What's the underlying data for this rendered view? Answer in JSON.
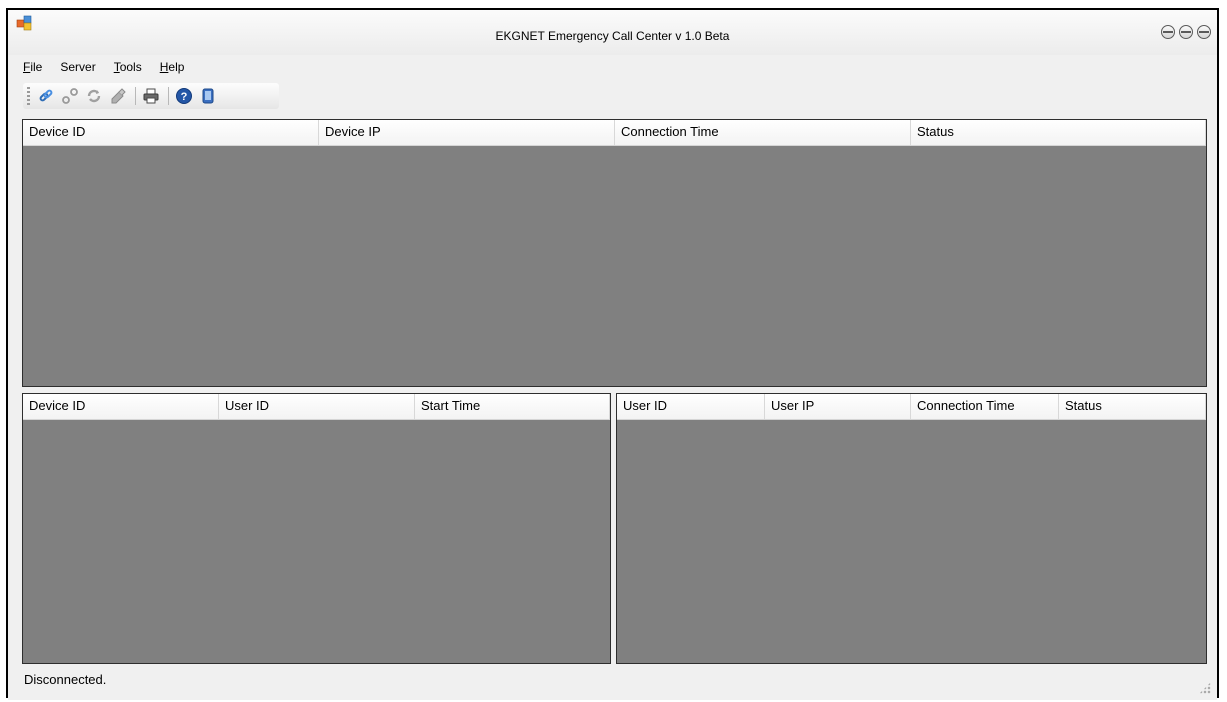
{
  "window": {
    "title": "EKGNET Emergency Call Center v 1.0 Beta"
  },
  "menu": [
    {
      "mnemonic": "F",
      "rest": "ile"
    },
    {
      "mnemonic": "",
      "rest": "Server"
    },
    {
      "mnemonic": "T",
      "rest": "ools"
    },
    {
      "mnemonic": "H",
      "rest": "elp"
    }
  ],
  "toolbar": {
    "icons": [
      "connect-icon",
      "disconnect-icon",
      "refresh-icon",
      "clear-icon",
      "print-icon",
      "help-icon",
      "about-icon"
    ]
  },
  "devices_table": {
    "columns": [
      "Device ID",
      "Device IP",
      "Connection Time",
      "Status"
    ]
  },
  "calls_table": {
    "columns": [
      "Device ID",
      "User ID",
      "Start Time"
    ]
  },
  "users_table": {
    "columns": [
      "User ID",
      "User IP",
      "Connection Time",
      "Status"
    ]
  },
  "status": {
    "text": "Disconnected."
  },
  "colors": {
    "panel_bg": "#808080",
    "window_bg": "#f0f0f0"
  }
}
